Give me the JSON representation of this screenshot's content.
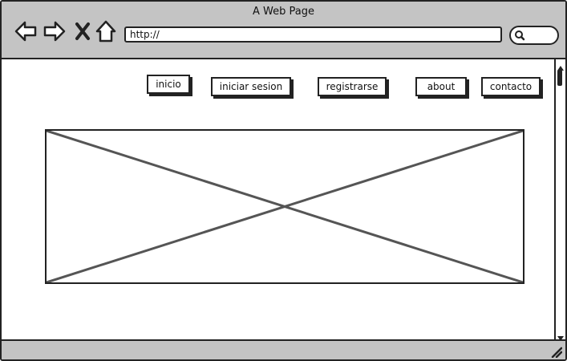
{
  "window": {
    "title": "A Web Page"
  },
  "toolbar": {
    "back_icon": "back-arrow-icon",
    "forward_icon": "forward-arrow-icon",
    "stop_icon": "close-icon",
    "home_icon": "home-icon",
    "address_value": "http://",
    "search_icon": "search-icon"
  },
  "nav": {
    "items": [
      {
        "label": "inicio"
      },
      {
        "label": "iniciar sesion"
      },
      {
        "label": "registrarse"
      },
      {
        "label": "about"
      },
      {
        "label": "contacto"
      }
    ]
  },
  "colors": {
    "chrome": "#c4c4c4",
    "border": "#222222",
    "placeholder_lines": "#555555"
  }
}
